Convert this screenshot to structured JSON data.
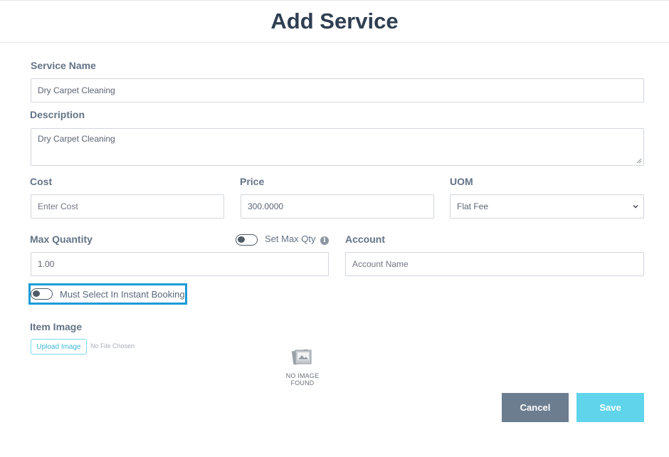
{
  "header": {
    "title": "Add Service"
  },
  "form": {
    "service_name": {
      "label": "Service Name",
      "value": "Dry Carpet Cleaning"
    },
    "description": {
      "label": "Description",
      "value": "Dry Carpet Cleaning"
    },
    "cost": {
      "label": "Cost",
      "value": "",
      "placeholder": "Enter Cost"
    },
    "price": {
      "label": "Price",
      "value": "300.0000"
    },
    "uom": {
      "label": "UOM",
      "selected": "Flat Fee"
    },
    "max_quantity": {
      "label": "Max Quantity",
      "value": "1.00"
    },
    "set_max_qty": {
      "label": "Set Max Qty",
      "enabled": false
    },
    "account": {
      "label": "Account",
      "value": "",
      "placeholder": "Account Name"
    },
    "must_select": {
      "label": "Must Select In Instant Booking",
      "enabled": false
    },
    "item_image": {
      "label": "Item Image",
      "upload_label": "Upload Image",
      "file_status": "No File Chosen",
      "no_image_line1": "NO IMAGE",
      "no_image_line2": "FOUND"
    }
  },
  "actions": {
    "cancel_label": "Cancel",
    "save_label": "Save"
  },
  "icons": {
    "info": "info-icon",
    "select_chevron": "chevron-down-icon",
    "no_image": "image-placeholder-icon"
  },
  "colors": {
    "title": "#2f3e51",
    "label": "#637386",
    "highlight_border": "#1b9bd7",
    "cancel_button": "#6c7d8f",
    "save_button": "#5fd4ea",
    "upload_text": "#3cb9d6"
  }
}
